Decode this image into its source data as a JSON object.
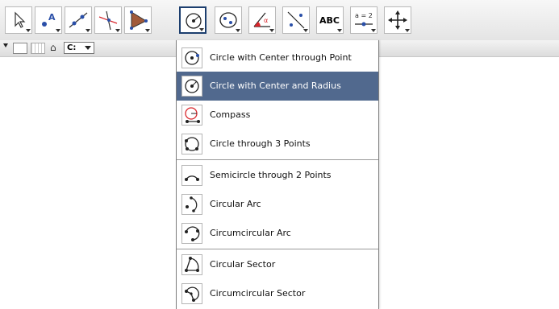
{
  "toolbar": {
    "tools": [
      {
        "name": "move-tool-button",
        "icon": "arrow-cursor-icon"
      },
      {
        "name": "point-tool-button",
        "icon": "point-icon",
        "letter": "A"
      },
      {
        "name": "line-tool-button",
        "icon": "line-icon"
      },
      {
        "name": "perpendicular-tool-button",
        "icon": "perpendicular-line-icon"
      },
      {
        "name": "polygon-tool-button",
        "icon": "polygon-icon"
      },
      {
        "name": "circle-tool-button",
        "icon": "circle-center-icon",
        "selected": true
      },
      {
        "name": "conic-tool-button",
        "icon": "ellipse-icon"
      },
      {
        "name": "angle-tool-button",
        "icon": "angle-icon",
        "letter": "α"
      },
      {
        "name": "reflect-tool-button",
        "icon": "reflect-icon"
      },
      {
        "name": "text-tool-button",
        "icon": "text-icon",
        "label": "ABC"
      },
      {
        "name": "slider-tool-button",
        "icon": "slider-icon",
        "label": "a = 2"
      },
      {
        "name": "move-graphics-tool-button",
        "icon": "move-graphics-icon"
      }
    ]
  },
  "subbar": {
    "font_box": "C:"
  },
  "menu": {
    "items": [
      {
        "label": "Circle with Center through Point",
        "icon": "circle-center-point-icon"
      },
      {
        "label": "Circle with Center and Radius",
        "icon": "circle-center-radius-icon",
        "highlighted": true
      },
      {
        "label": "Compass",
        "icon": "compass-icon"
      },
      {
        "label": "Circle through 3 Points",
        "icon": "circle-three-points-icon"
      },
      {
        "label": "Semicircle through 2 Points",
        "icon": "semicircle-icon"
      },
      {
        "label": "Circular Arc",
        "icon": "circular-arc-icon"
      },
      {
        "label": "Circumcircular Arc",
        "icon": "circumcircular-arc-icon"
      },
      {
        "label": "Circular Sector",
        "icon": "circular-sector-icon"
      },
      {
        "label": "Circumcircular Sector",
        "icon": "circumcircular-sector-icon"
      }
    ]
  },
  "colors": {
    "highlight": "#51698e",
    "selected_border": "#1c3e6e",
    "point_blue": "#2a4fa8",
    "compass_red": "#d8262b"
  }
}
